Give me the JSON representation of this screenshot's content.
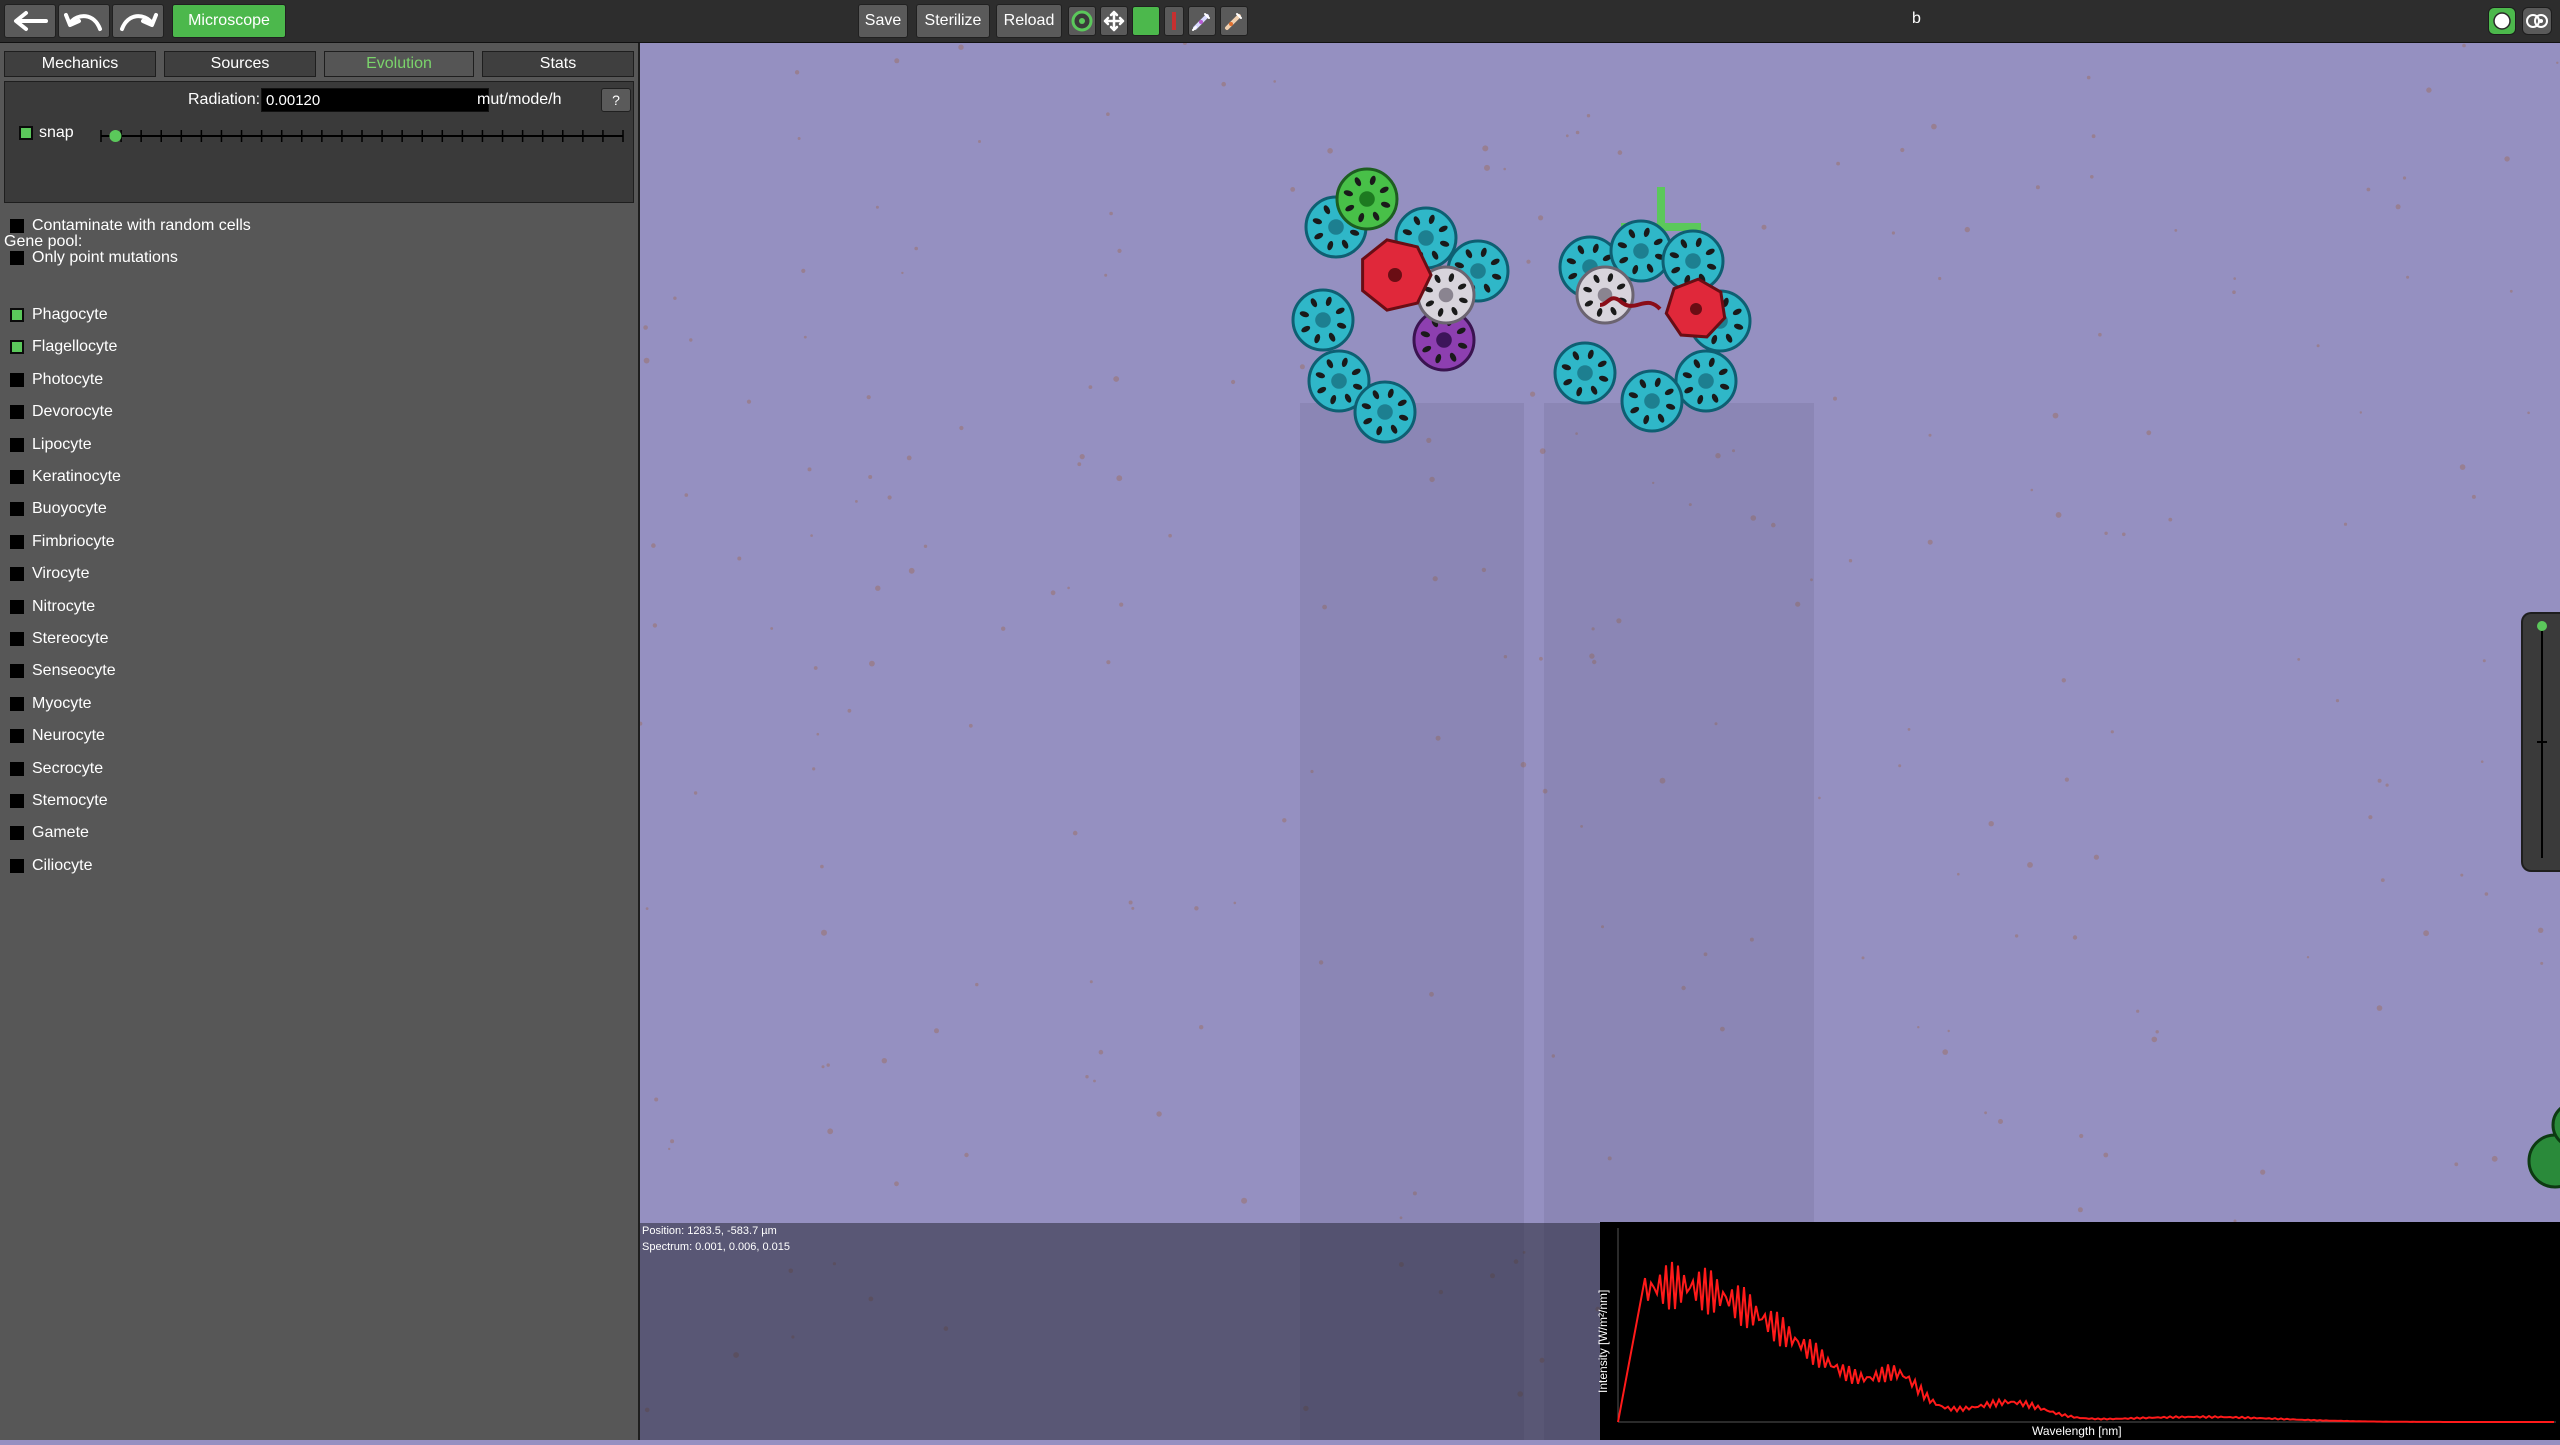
{
  "toolbar": {
    "microscope_label": "Microscope",
    "save_label": "Save",
    "sterilize_label": "Sterilize",
    "reload_label": "Reload",
    "center_letter": "b"
  },
  "tabs": [
    {
      "label": "Mechanics",
      "active": false
    },
    {
      "label": "Sources",
      "active": false
    },
    {
      "label": "Evolution",
      "active": true
    },
    {
      "label": "Stats",
      "active": false
    }
  ],
  "evolution": {
    "radiation_label": "Radiation:",
    "radiation_value": "0.00120",
    "radiation_unit": "mut/mode/h",
    "help_label": "?",
    "snap_label": "snap",
    "snap_checked": true,
    "slider_position": 0.02
  },
  "options": [
    {
      "label": "Contaminate with random cells",
      "checked": false
    },
    {
      "label": "Only point mutations",
      "checked": false
    }
  ],
  "gene_pool_label": "Gene pool:",
  "gene_pool": [
    {
      "label": "Phagocyte",
      "checked": true
    },
    {
      "label": "Flagellocyte",
      "checked": true
    },
    {
      "label": "Photocyte",
      "checked": false
    },
    {
      "label": "Devorocyte",
      "checked": false
    },
    {
      "label": "Lipocyte",
      "checked": false
    },
    {
      "label": "Keratinocyte",
      "checked": false
    },
    {
      "label": "Buoyocyte",
      "checked": false
    },
    {
      "label": "Fimbriocyte",
      "checked": false
    },
    {
      "label": "Virocyte",
      "checked": false
    },
    {
      "label": "Nitrocyte",
      "checked": false
    },
    {
      "label": "Stereocyte",
      "checked": false
    },
    {
      "label": "Senseocyte",
      "checked": false
    },
    {
      "label": "Myocyte",
      "checked": false
    },
    {
      "label": "Neurocyte",
      "checked": false
    },
    {
      "label": "Secrocyte",
      "checked": false
    },
    {
      "label": "Stemocyte",
      "checked": false
    },
    {
      "label": "Gamete",
      "checked": false
    },
    {
      "label": "Ciliocyte",
      "checked": false
    }
  ],
  "info": {
    "position": "Position: 1283.5, -583.7 µm",
    "spectrum": "Spectrum: 0.001, 0.006,  0.015"
  },
  "spectrum_chart": {
    "ylabel": "Intensity [W/m²/nm]",
    "xlabel": "Wavelength [nm]"
  },
  "colors": {
    "accent": "#4cb84c",
    "background": "#9590c1",
    "panel": "#575757",
    "phagocyte": "#2fb7c8",
    "flagellocyte": "#e0283a",
    "spectrum_line": "#ff1a1a"
  }
}
